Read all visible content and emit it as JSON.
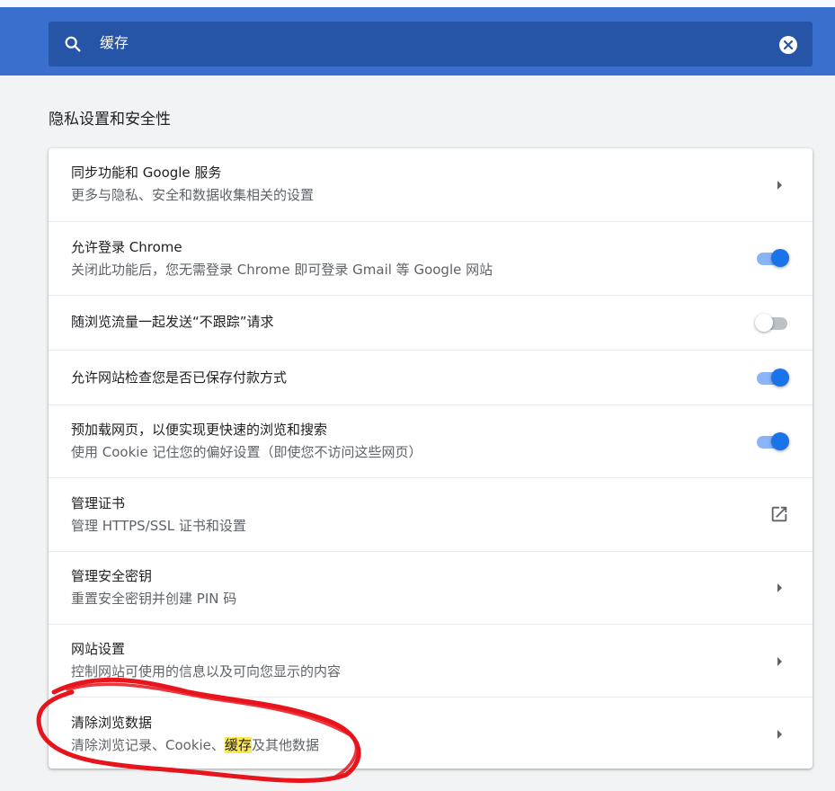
{
  "search": {
    "query": "缓存",
    "icon": "search-icon",
    "clear_icon": "clear-icon"
  },
  "section": {
    "title": "隐私设置和安全性"
  },
  "rows": [
    {
      "label": "同步功能和 Google 服务",
      "sublabel": "更多与隐私、安全和数据收集相关的设置",
      "control": "arrow"
    },
    {
      "label": "允许登录 Chrome",
      "sublabel": "关闭此功能后，您无需登录 Chrome 即可登录 Gmail 等 Google 网站",
      "control": "toggle",
      "enabled": true
    },
    {
      "label": "随浏览流量一起发送“不跟踪”请求",
      "control": "toggle",
      "enabled": false
    },
    {
      "label": "允许网站检查您是否已保存付款方式",
      "control": "toggle",
      "enabled": true
    },
    {
      "label": "预加载网页，以便实现更快速的浏览和搜索",
      "sublabel": "使用 Cookie 记住您的偏好设置（即使您不访问这些网页）",
      "control": "toggle",
      "enabled": true
    },
    {
      "label": "管理证书",
      "sublabel": "管理 HTTPS/SSL 证书和设置",
      "control": "external-link"
    },
    {
      "label": "管理安全密钥",
      "sublabel": "重置安全密钥并创建 PIN 码",
      "control": "arrow"
    },
    {
      "label": "网站设置",
      "sublabel": "控制网站可使用的信息以及可向您显示的内容",
      "control": "arrow"
    },
    {
      "label": "清除浏览数据",
      "sublabel_pre": "清除浏览记录、Cookie、",
      "sublabel_highlight": "缓存",
      "sublabel_post": "及其他数据",
      "control": "arrow"
    }
  ],
  "colors": {
    "header": "#3b6fce",
    "searchbar": "#2654a7",
    "toggle_on": "#1a73e8",
    "highlight": "#fce94f",
    "annotation": "#e8141c"
  }
}
